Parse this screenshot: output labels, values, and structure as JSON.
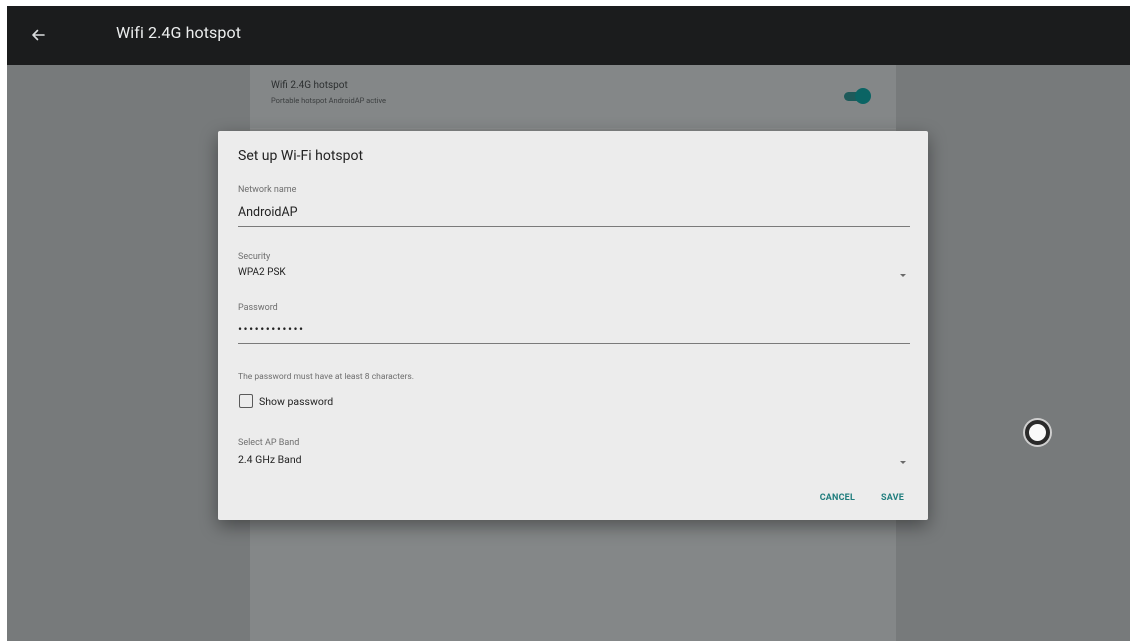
{
  "appbar": {
    "title": "Wifi 2.4G hotspot",
    "back_icon": "arrow-left-icon"
  },
  "preference": {
    "title": "Wifi 2.4G hotspot",
    "summary": "Portable hotspot AndroidAP active",
    "toggle_on": true
  },
  "dialog": {
    "title": "Set up Wi-Fi hotspot",
    "network_name": {
      "label": "Network name",
      "value": "AndroidAP"
    },
    "security": {
      "label": "Security",
      "value": "WPA2 PSK"
    },
    "password": {
      "label": "Password",
      "value": "••••••••••••"
    },
    "hint": "The password must have at least 8 characters.",
    "show_password": {
      "label": "Show password",
      "checked": false
    },
    "ap_band": {
      "label": "Select AP Band",
      "value": "2.4 GHz Band"
    },
    "cancel_label": "CANCEL",
    "save_label": "SAVE"
  },
  "colors": {
    "accent": "#1f7d7d",
    "appbar": "#1b1c1d",
    "dialog": "#ececec",
    "scrim": "#777a7b"
  }
}
